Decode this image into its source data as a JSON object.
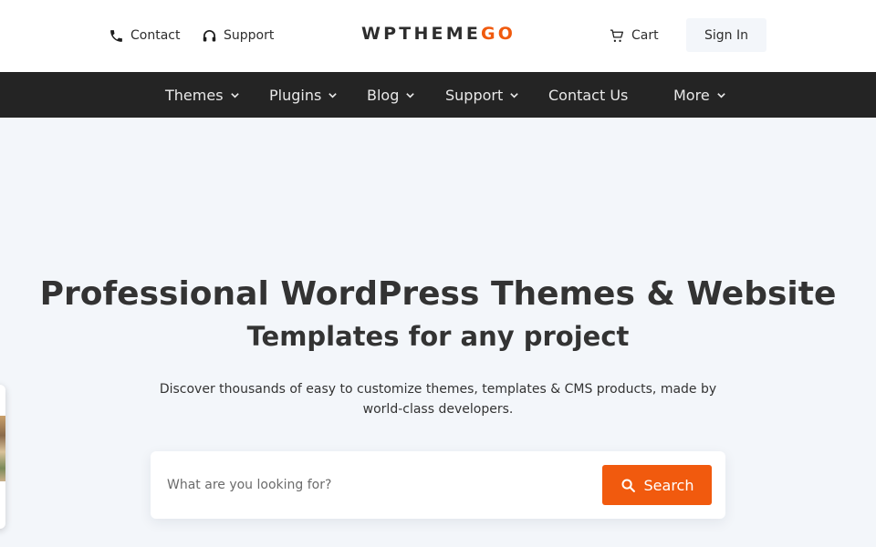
{
  "header": {
    "contact_label": "Contact",
    "support_label": "Support",
    "logo_main": "WPTHEME",
    "logo_accent": "GO",
    "cart_label": "Cart",
    "signin_label": "Sign In"
  },
  "nav": {
    "items": [
      {
        "label": "Themes",
        "dropdown": true
      },
      {
        "label": "Plugins",
        "dropdown": true
      },
      {
        "label": "Blog",
        "dropdown": true
      },
      {
        "label": "Support",
        "dropdown": true
      },
      {
        "label": "Contact Us",
        "dropdown": false
      },
      {
        "label": "More",
        "dropdown": true
      }
    ]
  },
  "hero": {
    "title_line1": "Professional WordPress Themes & Website",
    "title_line2": "Templates for any project",
    "description": "Discover thousands of easy to customize themes, templates & CMS products, made by world-class developers."
  },
  "search": {
    "placeholder": "What are you looking for?",
    "value": "",
    "button_label": "Search"
  },
  "colors": {
    "accent": "#f15a0e",
    "nav_bg": "#242424",
    "hero_bg": "#f3f6fa",
    "text": "#333333"
  },
  "icons": {
    "contact": "phone-icon",
    "support": "headset-icon",
    "cart": "cart-icon",
    "search": "search-icon",
    "dropdown": "chevron-down-icon"
  }
}
